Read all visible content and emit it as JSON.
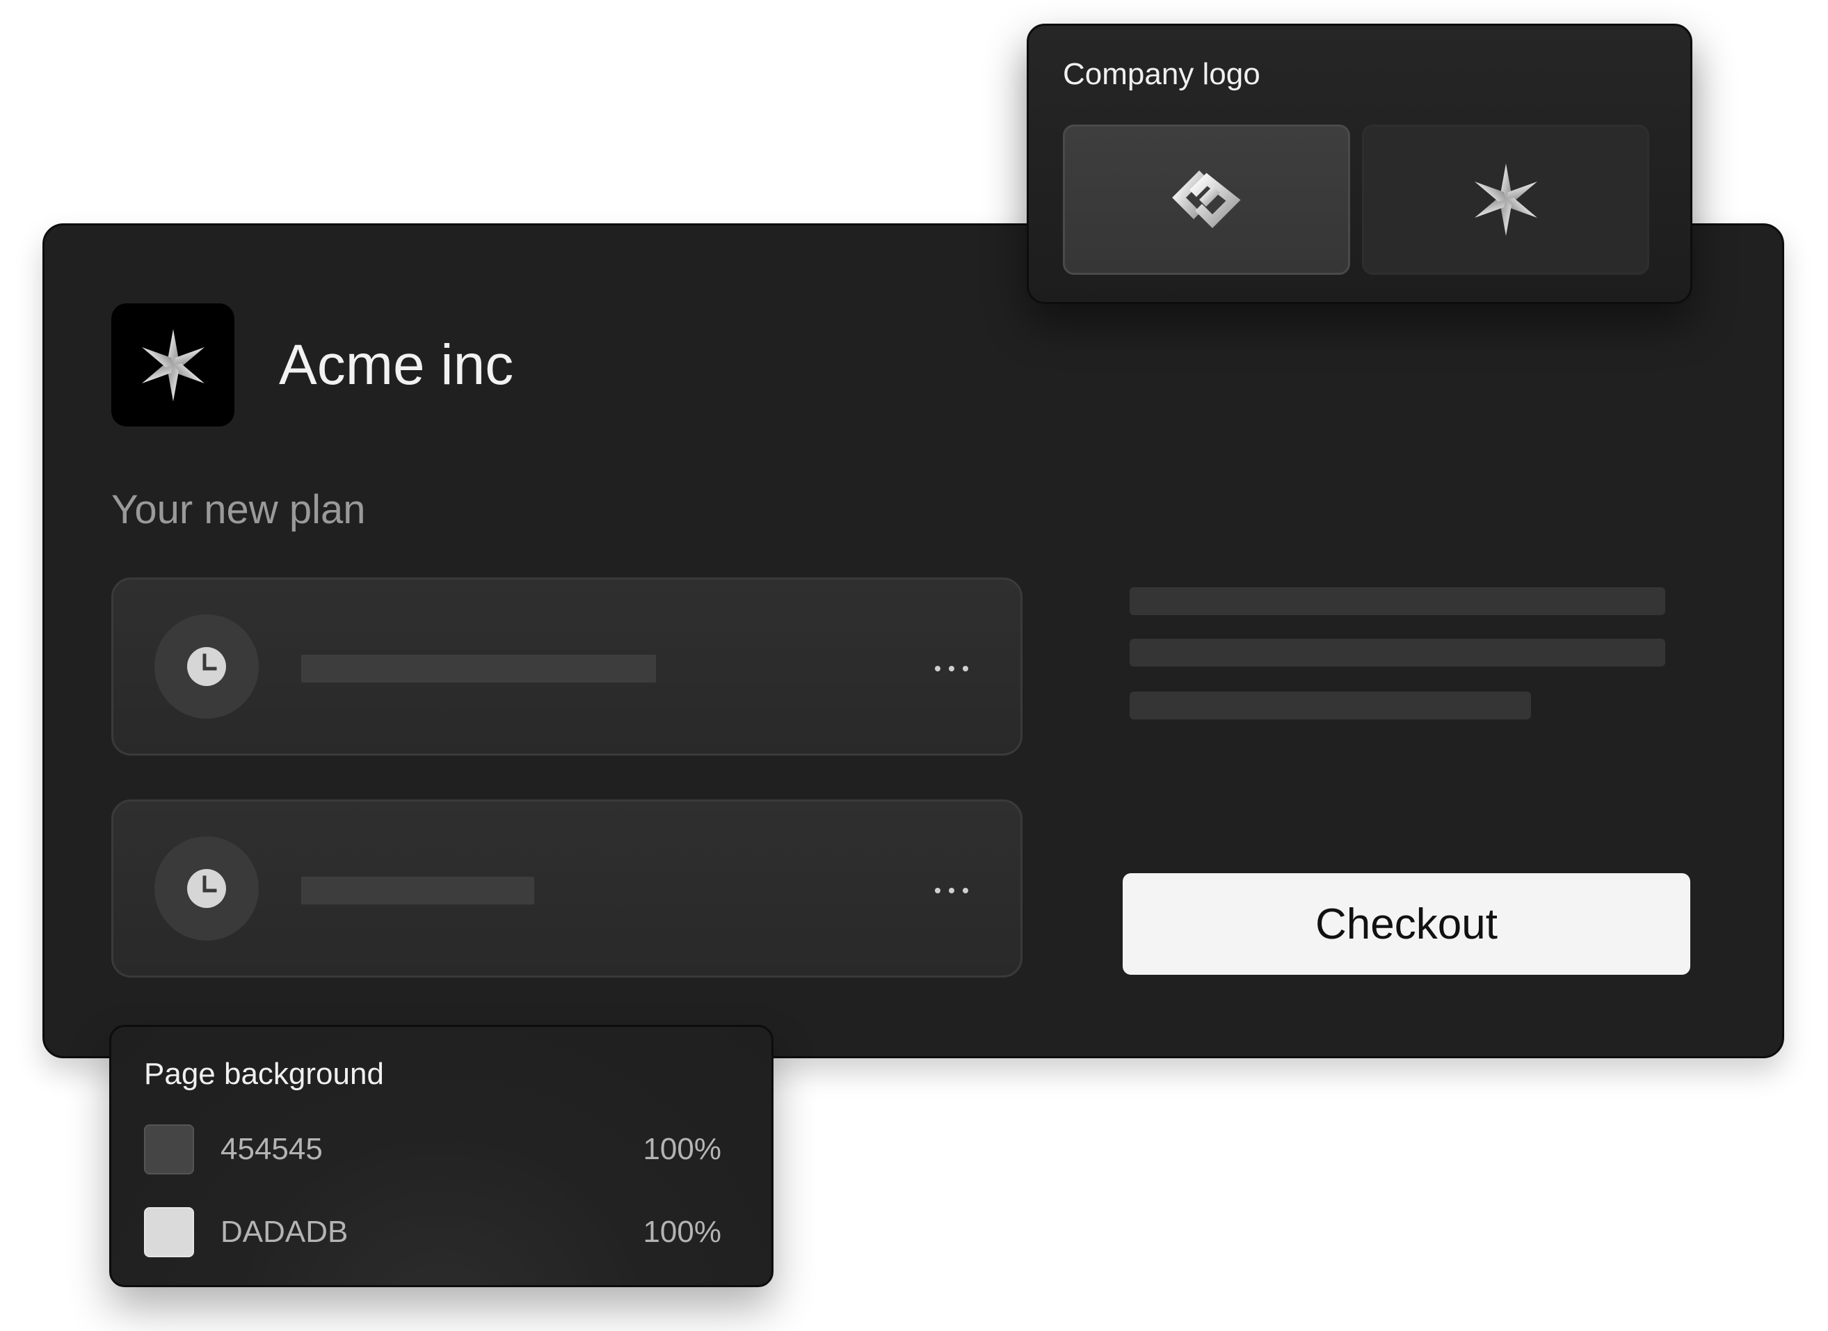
{
  "brand": {
    "name": "Acme inc",
    "logo_icon": "sparkle-star-icon"
  },
  "plan": {
    "title": "Your new plan",
    "items": [
      {
        "icon": "clock-icon",
        "menu_icon": "more-horizontal-icon"
      },
      {
        "icon": "clock-icon",
        "menu_icon": "more-horizontal-icon"
      }
    ]
  },
  "checkout": {
    "button_label": "Checkout"
  },
  "company_logo_panel": {
    "title": "Company logo",
    "options": [
      {
        "icon": "interlocking-diamond-logo-icon",
        "selected": true
      },
      {
        "icon": "sparkle-star-icon",
        "selected": false
      }
    ]
  },
  "page_background_panel": {
    "title": "Page background",
    "colors": [
      {
        "hex": "454545",
        "opacity": "100%",
        "swatch_color": "#454545"
      },
      {
        "hex": "DADADB",
        "opacity": "100%",
        "swatch_color": "#DADADB"
      }
    ]
  },
  "colors": {
    "card_background": "#202020",
    "button_background": "#F4F4F4",
    "page_background": "#FFFFFF"
  }
}
